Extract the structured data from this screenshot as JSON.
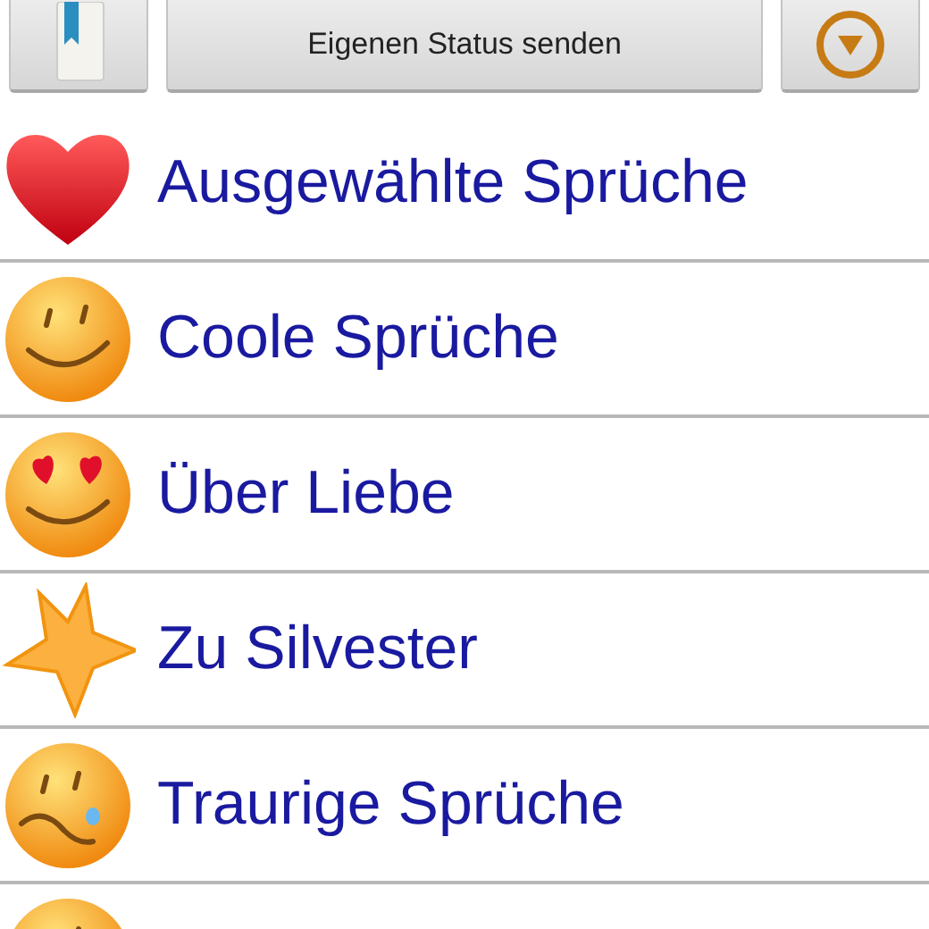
{
  "toolbar": {
    "send_button": "Eigenen Status senden"
  },
  "categories": [
    {
      "kind": "heart",
      "label": "Ausgewählte Sprüche"
    },
    {
      "kind": "smile",
      "label": "Coole Sprüche"
    },
    {
      "kind": "love",
      "label": "Über Liebe"
    },
    {
      "kind": "star",
      "label": "Zu Silvester"
    },
    {
      "kind": "sad",
      "label": "Traurige Sprüche"
    },
    {
      "kind": "sad"
    }
  ]
}
